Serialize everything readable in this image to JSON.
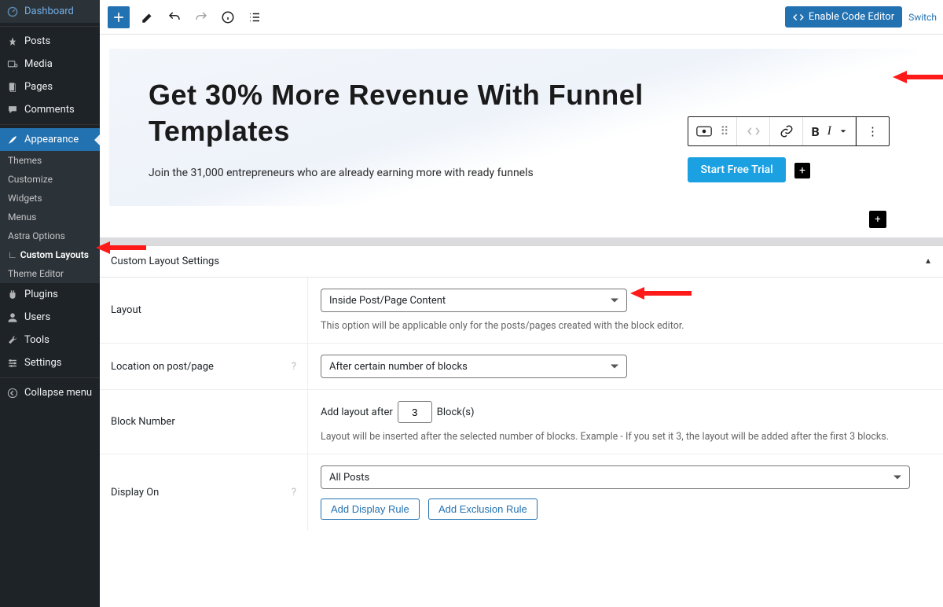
{
  "sidebar": {
    "items": [
      {
        "label": "Dashboard",
        "icon": "dashboard"
      },
      {
        "label": "Posts",
        "icon": "pin"
      },
      {
        "label": "Media",
        "icon": "media"
      },
      {
        "label": "Pages",
        "icon": "page"
      },
      {
        "label": "Comments",
        "icon": "comment"
      },
      {
        "label": "Appearance",
        "icon": "brush",
        "active": true
      },
      {
        "label": "Plugins",
        "icon": "plugin"
      },
      {
        "label": "Users",
        "icon": "user"
      },
      {
        "label": "Tools",
        "icon": "tool"
      },
      {
        "label": "Settings",
        "icon": "gear"
      },
      {
        "label": "Collapse menu",
        "icon": "collapse"
      }
    ],
    "submenu": [
      "Themes",
      "Customize",
      "Widgets",
      "Menus",
      "Astra Options",
      "Custom Layouts",
      "Theme Editor"
    ],
    "submenu_active_index": 5
  },
  "toolbar": {
    "code_editor_label": "Enable Code Editor",
    "switch_label": "Switch"
  },
  "hero": {
    "title": "Get 30% More Revenue With Funnel Templates",
    "subtitle": "Join the 31,000 entrepreneurs who are already earning more with ready funnels",
    "cta_label": "Start Free Trial"
  },
  "settings": {
    "panel_title": "Custom Layout Settings",
    "rows": {
      "layout": {
        "label": "Layout",
        "value": "Inside Post/Page Content",
        "help": "This option will be applicable only for the posts/pages created with the block editor."
      },
      "location": {
        "label": "Location on post/page",
        "value": "After certain number of blocks"
      },
      "block_number": {
        "label": "Block Number",
        "prefix": "Add layout after",
        "value": "3",
        "suffix": "Block(s)",
        "help": "Layout will be inserted after the selected number of blocks. Example - If you set it 3, the layout will be added after the first 3 blocks."
      },
      "display_on": {
        "label": "Display On",
        "value": "All Posts",
        "btn1": "Add Display Rule",
        "btn2": "Add Exclusion Rule"
      }
    }
  }
}
